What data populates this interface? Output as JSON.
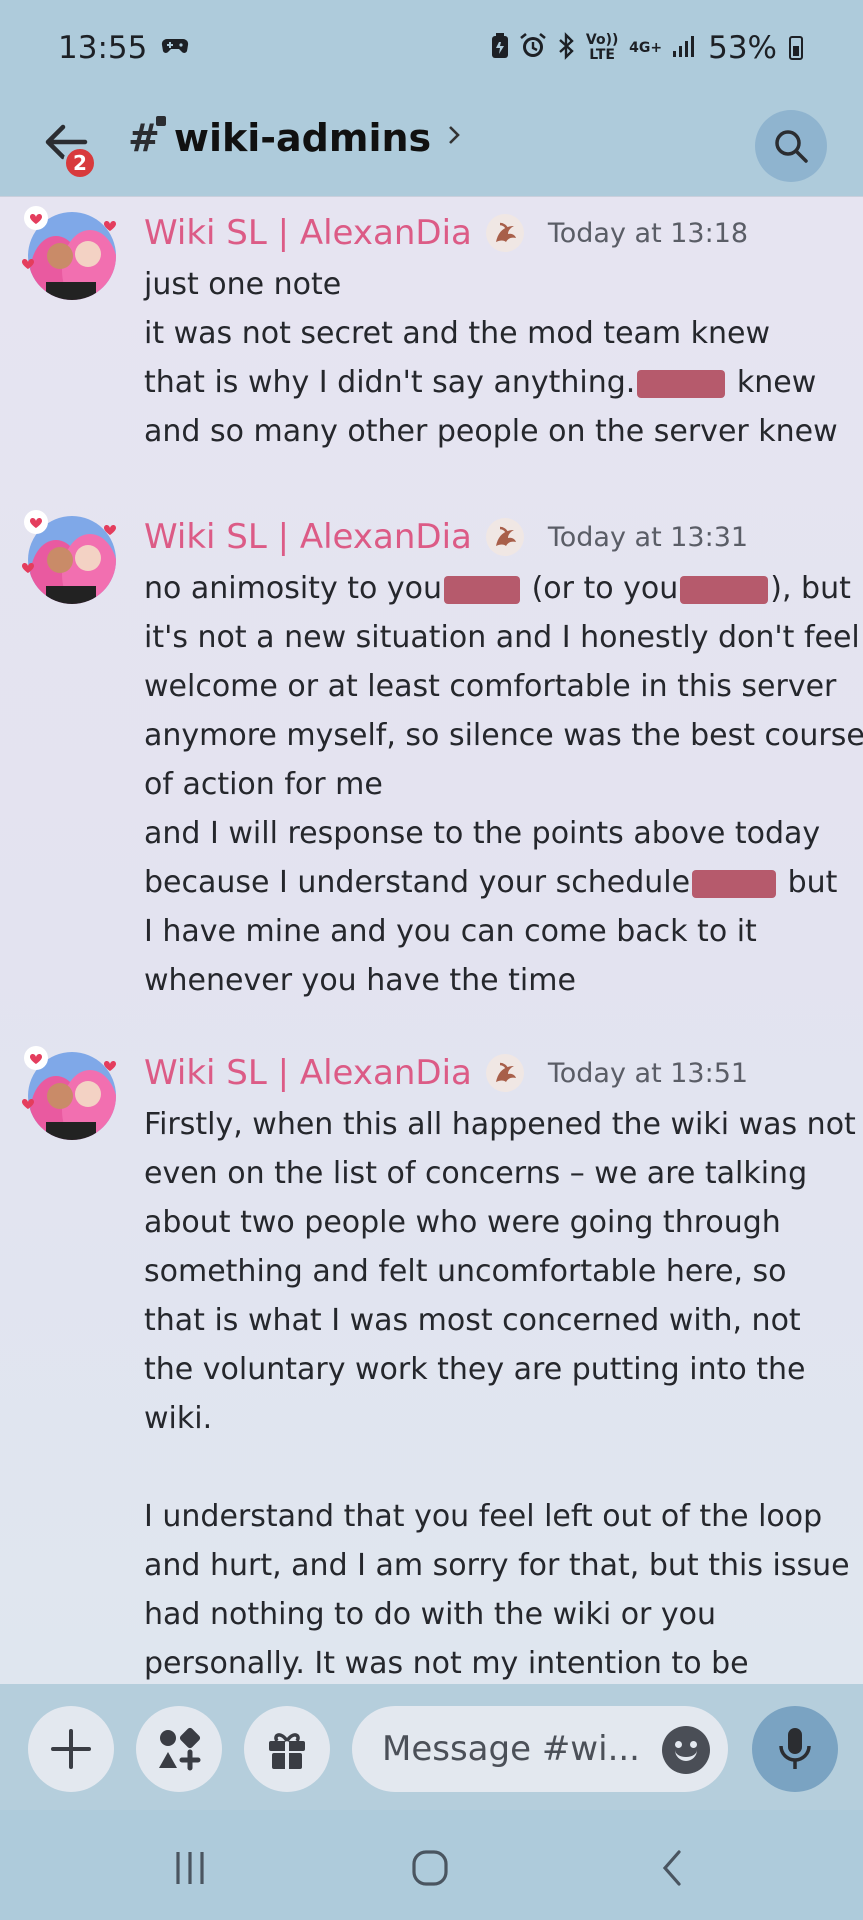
{
  "status_bar": {
    "time": "13:55",
    "volte": "Vo)) LTE",
    "network": "4G+",
    "battery": "53%"
  },
  "header": {
    "back_badge": "2",
    "channel_name": "wiki-admins"
  },
  "messages": [
    {
      "username": "Wiki SL | AlexanDia",
      "timestamp": "Today at 13:18",
      "lines": [
        "just one note",
        "it was not secret and the mod team knew",
        "that is why I didn't say anything.",
        "knew",
        "and so many other people on the server knew"
      ]
    },
    {
      "username": "Wiki SL | AlexanDia",
      "timestamp": "Today at 13:31",
      "lines": [
        "no animosity to you",
        "(or to you",
        "), but",
        "it's not a new situation and I honestly don't feel",
        "welcome or at least comfortable in this server",
        "anymore myself, so silence was the best course",
        "of action for me",
        "and I will response to the points above today",
        "because I understand your schedule",
        "but",
        "I have mine and you can come back to it",
        "whenever you have the time"
      ]
    },
    {
      "username": "Wiki SL | AlexanDia",
      "timestamp": "Today at 13:51",
      "lines": [
        "Firstly, when this all happened the wiki was not",
        "even on the list of concerns – we are talking",
        "about two people who were going through",
        "something and felt uncomfortable here, so",
        "that is what I was most concerned with, not",
        "the voluntary work they are putting into the",
        "wiki.",
        "I understand that you feel left out of the loop",
        "and hurt, and I am sorry for that, but this issue",
        "had nothing to do with the wiki or you",
        "personally. It was not my intention to be"
      ]
    }
  ],
  "composer": {
    "placeholder": "Message #wi..."
  },
  "colors": {
    "header_bg": "#aecbdb",
    "username": "#dc5b86",
    "redaction": "#b65a6c",
    "badge": "#d83a3c"
  },
  "icons": [
    "back-arrow-icon",
    "search-icon",
    "plus-icon",
    "apps-icon",
    "gift-icon",
    "emoji-icon",
    "microphone-icon",
    "recent-apps-icon",
    "home-icon",
    "back-icon"
  ]
}
